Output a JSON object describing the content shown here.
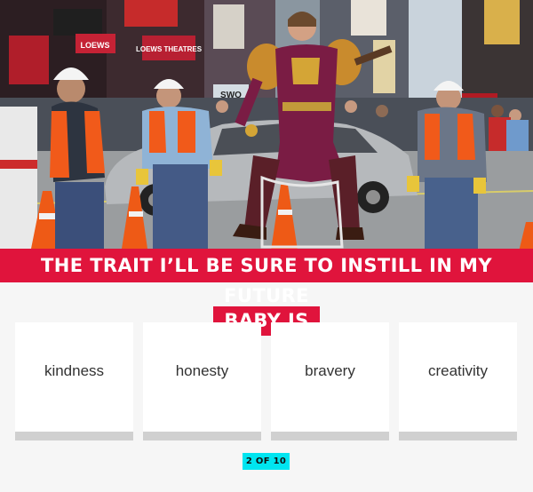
{
  "question": {
    "line1": "THE TRAIT I’LL BE SURE TO INSTILL IN MY FUTURE",
    "line2": "BABY IS"
  },
  "answers": [
    {
      "label": "kindness"
    },
    {
      "label": "honesty"
    },
    {
      "label": "bravery"
    },
    {
      "label": "creativity"
    }
  ],
  "progress": {
    "label": "2 OF 10"
  },
  "photo": {
    "signs": [
      "LOEWS",
      "LOEWS THEATRES",
      "SWO"
    ]
  },
  "colors": {
    "accent": "#e0143c",
    "progress": "#00e5f0",
    "card_border": "#d0d0d0",
    "background": "#f6f6f6"
  }
}
